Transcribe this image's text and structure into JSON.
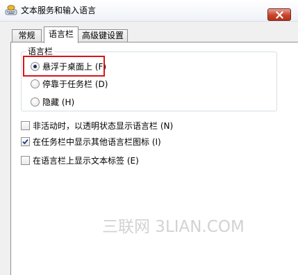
{
  "window": {
    "title": "文本服务和输入语言",
    "icon": "keyboard-icon",
    "close_icon": "close-x-icon"
  },
  "tabs": [
    {
      "label": "常规",
      "selected": false
    },
    {
      "label": "语言栏",
      "selected": true
    },
    {
      "label": "高级键设置",
      "selected": false
    }
  ],
  "language_bar_group": {
    "title": "语言栏",
    "options": [
      {
        "label": "悬浮于桌面上 (F)",
        "checked": true
      },
      {
        "label": "停靠于任务栏 (D)",
        "checked": false
      },
      {
        "label": "隐藏 (H)",
        "checked": false
      }
    ]
  },
  "checkboxes": [
    {
      "label": "非活动时，以透明状态显示语言栏 (N)",
      "checked": false
    },
    {
      "label": "在任务栏中显示其他语言栏图标 (I)",
      "checked": true
    },
    {
      "label": "在语言栏上显示文本标签 (E)",
      "checked": false
    }
  ],
  "annotation": {
    "highlight_color": "#d9141a"
  },
  "watermark": "三联网 3LIAN.COM"
}
